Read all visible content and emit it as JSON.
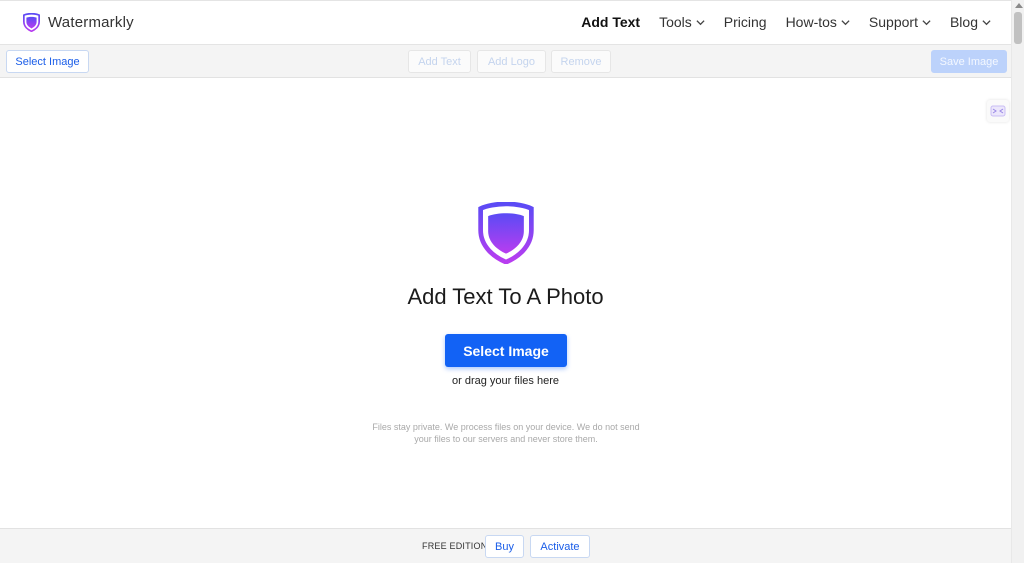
{
  "app": {
    "name": "Watermarkly"
  },
  "nav": {
    "items": [
      {
        "label": "Add Text",
        "active": true,
        "dropdown": false
      },
      {
        "label": "Tools",
        "active": false,
        "dropdown": true
      },
      {
        "label": "Pricing",
        "active": false,
        "dropdown": false
      },
      {
        "label": "How-tos",
        "active": false,
        "dropdown": true
      },
      {
        "label": "Support",
        "active": false,
        "dropdown": true
      },
      {
        "label": "Blog",
        "active": false,
        "dropdown": true
      }
    ]
  },
  "toolbar": {
    "select_image": "Select Image",
    "add_text": "Add Text",
    "add_logo": "Add Logo",
    "remove": "Remove",
    "save_image": "Save Image"
  },
  "main": {
    "title": "Add Text To A Photo",
    "cta_label": "Select Image",
    "drag_hint": "or drag your files here",
    "privacy_note": "Files stay private. We process files on your device. We do not send your files to our servers and never store them."
  },
  "footer": {
    "edition": "FREE EDITION",
    "buy": "Buy",
    "activate": "Activate"
  },
  "colors": {
    "accent": "#1262f5",
    "logo_gradient_start": "#5b4bf5",
    "logo_gradient_end": "#b93df0"
  },
  "icons": {
    "brand": "shield-logo-icon",
    "chevron": "chevron-down-icon",
    "side_widget": "chat-widget-icon"
  }
}
